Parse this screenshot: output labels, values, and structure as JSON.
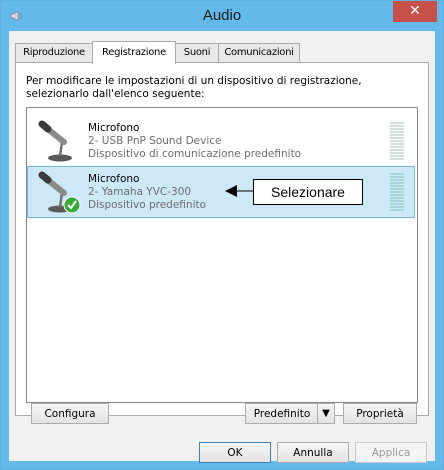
{
  "window": {
    "title": "Audio",
    "close_glyph": "✕"
  },
  "tabs": [
    {
      "label": "Riproduzione",
      "active": false
    },
    {
      "label": "Registrazione",
      "active": true
    },
    {
      "label": "Suoni",
      "active": false
    },
    {
      "label": "Comunicazioni",
      "active": false
    }
  ],
  "panel": {
    "description": "Per modificare le impostazioni di un dispositivo di registrazione, selezionarlo dall'elenco seguente:"
  },
  "devices": [
    {
      "name": "Microfono",
      "line1": "2- USB PnP Sound Device",
      "line2": "Dispositivo di comunicazione predefinito",
      "selected": false,
      "icon": "microphone-icon"
    },
    {
      "name": "Microfono",
      "line1": "2- Yamaha YVC-300",
      "line2": "Dispositivo predefinito",
      "selected": true,
      "icon": "microphone-default-icon"
    }
  ],
  "callout": {
    "text": "Selezionare"
  },
  "buttons": {
    "configure": "Configura",
    "set_default": "Predefinito",
    "properties": "Proprietà",
    "ok": "OK",
    "cancel": "Annulla",
    "apply": "Applica"
  },
  "colors": {
    "titlebar": "#63b9ea",
    "close": "#c7504b",
    "selection": "#cde8f7",
    "check": "#3aa83a"
  }
}
